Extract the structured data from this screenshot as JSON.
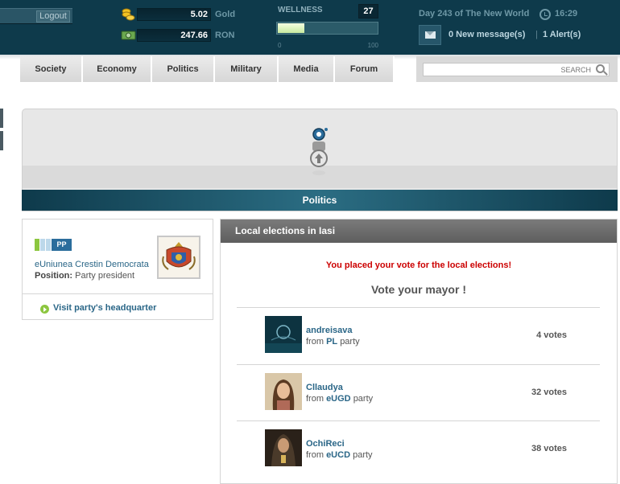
{
  "topbar": {
    "logout_label": "Logout",
    "gold": {
      "value": "5.02",
      "currency": "Gold",
      "icon": "gold-coins-icon"
    },
    "ron": {
      "value": "247.66",
      "currency": "RON",
      "icon": "cash-icon"
    },
    "wellness": {
      "label": "WELLNESS",
      "value": "27",
      "min": "0",
      "max": "100",
      "level_percent": 27
    },
    "day_text": "Day 243 of The New World",
    "time": "16:29",
    "messages_label": "0 New message(s)",
    "separator": "|",
    "alerts_label": "1 Alert(s)"
  },
  "nav": {
    "tabs": [
      "Society",
      "Economy",
      "Politics",
      "Military",
      "Media",
      "Forum"
    ],
    "search_placeholder": "SEARCH"
  },
  "hero": {
    "title": "Politics"
  },
  "party": {
    "badge": "PP",
    "name": "eUniunea Crestin Democrata",
    "position_label": "Position:",
    "position_value": "Party president",
    "hq_link": "Visit party's headquarter"
  },
  "elections": {
    "header": "Local elections in Iasi",
    "vote_message": "You placed your vote for the local elections!",
    "vote_title": "Vote your mayor !",
    "from_label": "from",
    "party_suffix": "party",
    "candidates": [
      {
        "name": "andreisava",
        "party": "PL",
        "votes": "4 votes"
      },
      {
        "name": "Cllaudya",
        "party": "eUGD",
        "votes": "32 votes"
      },
      {
        "name": "OchiReci",
        "party": "eUCD",
        "votes": "38 votes"
      }
    ]
  },
  "colors": {
    "topbar": "#0e3a4b",
    "link": "#2a6687",
    "alert_red": "#cc0000",
    "accent_green": "#8cc63f"
  }
}
